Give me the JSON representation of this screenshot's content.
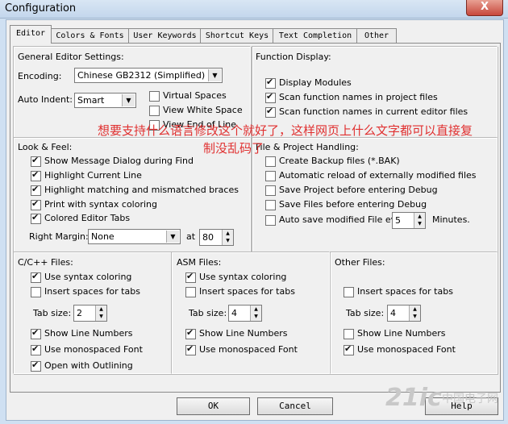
{
  "window": {
    "title": "Configuration",
    "close_glyph": "X"
  },
  "tabs": [
    "Editor",
    "Colors & Fonts",
    "User Keywords",
    "Shortcut Keys",
    "Text Completion",
    "Other"
  ],
  "general": {
    "title": "General Editor Settings:",
    "encoding_label": "Encoding:",
    "encoding_value": "Chinese GB2312 (Simplified)",
    "auto_indent_label": "Auto Indent:",
    "auto_indent_value": "Smart",
    "virtual_spaces": "Virtual Spaces",
    "view_white_space": "View White Space",
    "view_end_of_line": "View End of Line"
  },
  "function_display": {
    "title": "Function Display:",
    "items": [
      "Display Modules",
      "Scan function names in project files",
      "Scan function names in current editor files"
    ]
  },
  "look_feel": {
    "title": "Look & Feel:",
    "items": [
      "Show Message Dialog during Find",
      "Highlight Current Line",
      "Highlight matching and mismatched braces",
      "Print with syntax coloring",
      "Colored Editor Tabs"
    ],
    "right_margin_label": "Right Margin:",
    "right_margin_value": "None",
    "at_label": "at",
    "at_value": "80"
  },
  "file_project": {
    "title": "File & Project Handling:",
    "items": [
      "Create Backup files (*.BAK)",
      "Automatic reload of externally modified files",
      "Save Project before entering Debug",
      "Save Files before entering Debug",
      "Auto save modified File every"
    ],
    "auto_save_value": "5",
    "minutes_label": "Minutes."
  },
  "c_files": {
    "title": "C/C++ Files:",
    "syntax": "Use syntax coloring",
    "spaces": "Insert spaces for tabs",
    "tab_label": "Tab size:",
    "tab_value": "2",
    "line_numbers": "Show Line Numbers",
    "mono": "Use monospaced Font",
    "outlining": "Open with Outlining"
  },
  "asm_files": {
    "title": "ASM Files:",
    "syntax": "Use syntax coloring",
    "spaces": "Insert spaces for tabs",
    "tab_label": "Tab size:",
    "tab_value": "4",
    "line_numbers": "Show Line Numbers",
    "mono": "Use monospaced Font"
  },
  "other_files": {
    "title": "Other Files:",
    "spaces": "Insert spaces for tabs",
    "tab_label": "Tab size:",
    "tab_value": "4",
    "line_numbers": "Show Line Numbers",
    "mono": "Use monospaced Font"
  },
  "buttons": {
    "ok": "OK",
    "cancel": "Cancel",
    "help": "Help"
  },
  "overlay_text": {
    "line1": "想要支持什么语言修改这个就好了，这样网页上什么文字都可以直接复",
    "line2": "制没乱码了"
  },
  "watermark": {
    "main": "21ic",
    "sub": "中国电子网"
  },
  "colors": {
    "overlay": "#e03030",
    "title_bar": "#c3d6ec",
    "dialog_bg": "#f0f0f0",
    "close_button": "#c7473b"
  }
}
